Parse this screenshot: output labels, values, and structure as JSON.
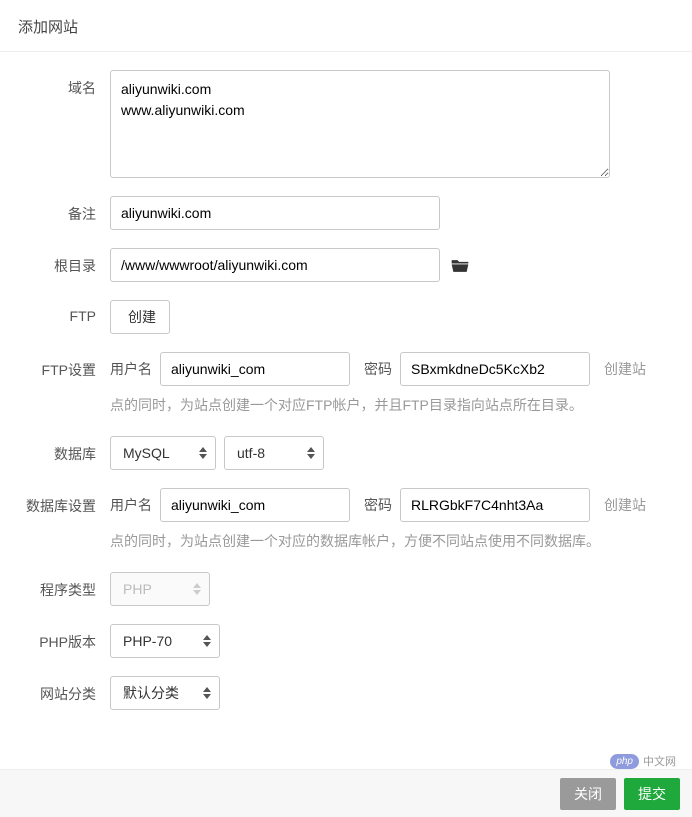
{
  "header": {
    "title": "添加网站"
  },
  "form": {
    "domain": {
      "label": "域名",
      "value": "aliyunwiki.com\nwww.aliyunwiki.com"
    },
    "remark": {
      "label": "备注",
      "value": "aliyunwiki.com"
    },
    "root": {
      "label": "根目录",
      "value": "/www/wwwroot/aliyunwiki.com"
    },
    "ftp": {
      "label": "FTP",
      "selected": "创建"
    },
    "ftp_settings": {
      "label": "FTP设置",
      "user_label": "用户名",
      "user_value": "aliyunwiki_com",
      "pwd_label": "密码",
      "pwd_value": "SBxmkdneDc5KcXb2",
      "hint_prefix": "创建站",
      "hint_rest": "点的同时，为站点创建一个对应FTP帐户，并且FTP目录指向站点所在目录。"
    },
    "database": {
      "label": "数据库",
      "engine": "MySQL",
      "charset": "utf-8"
    },
    "db_settings": {
      "label": "数据库设置",
      "user_label": "用户名",
      "user_value": "aliyunwiki_com",
      "pwd_label": "密码",
      "pwd_value": "RLRGbkF7C4nht3Aa",
      "hint_prefix": "创建站",
      "hint_rest": "点的同时，为站点创建一个对应的数据库帐户，方便不同站点使用不同数据库。"
    },
    "program": {
      "label": "程序类型",
      "value": "PHP"
    },
    "php_ver": {
      "label": "PHP版本",
      "value": "PHP-70"
    },
    "category": {
      "label": "网站分类",
      "value": "默认分类"
    }
  },
  "footer": {
    "close": "关闭",
    "submit": "提交"
  },
  "watermark": {
    "bubble": "php",
    "text": "中文网"
  }
}
